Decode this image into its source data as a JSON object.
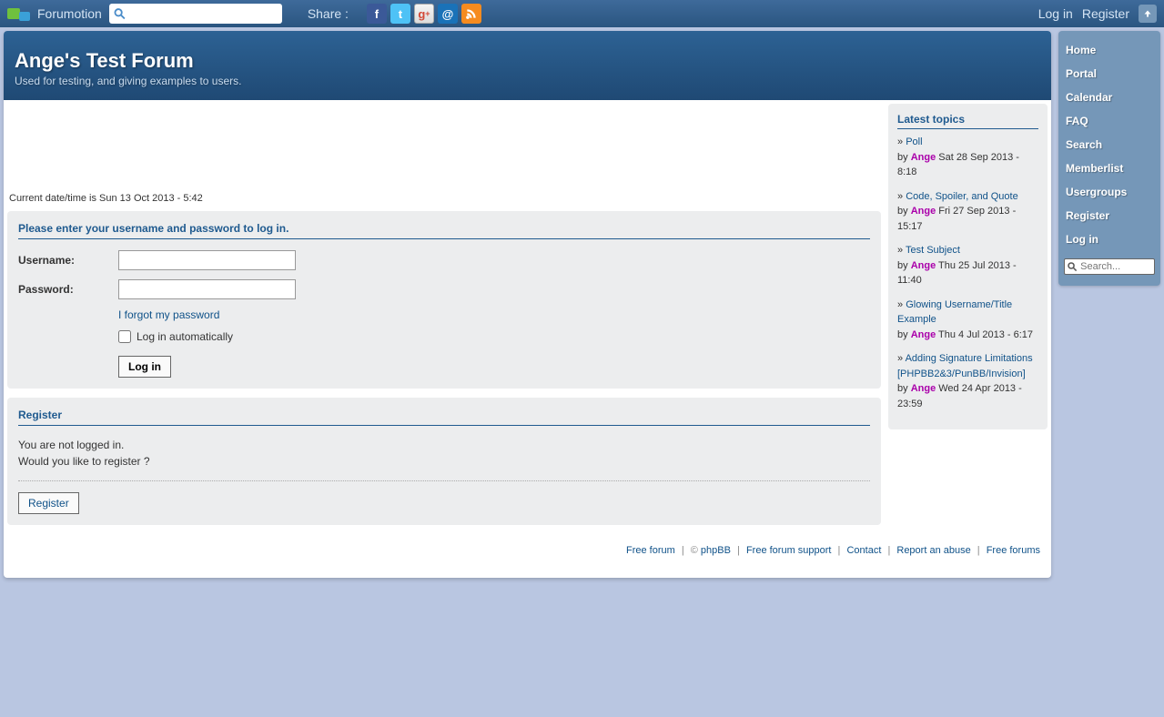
{
  "topbar": {
    "brand": "Forumotion",
    "share_label": "Share :",
    "login": "Log in",
    "register": "Register"
  },
  "banner": {
    "title": "Ange's Test Forum",
    "tagline": "Used for testing, and giving examples to users."
  },
  "datetime": "Current date/time is Sun 13 Oct 2013 - 5:42",
  "login_panel": {
    "title": "Please enter your username and password to log in.",
    "username_label": "Username:",
    "password_label": "Password:",
    "forgot": "I forgot my password",
    "auto": "Log in automatically",
    "button": "Log in"
  },
  "register_panel": {
    "title": "Register",
    "line1": "You are not logged in.",
    "line2": "Would you like to register ?",
    "button": "Register"
  },
  "latest": {
    "title": "Latest topics",
    "items": [
      {
        "title": "Poll",
        "user": "Ange",
        "ts": "Sat 28 Sep 2013 - 8:18"
      },
      {
        "title": "Code, Spoiler, and Quote",
        "user": "Ange",
        "ts": "Fri 27 Sep 2013 - 15:17"
      },
      {
        "title": "Test Subject",
        "user": "Ange",
        "ts": "Thu 25 Jul 2013 - 11:40"
      },
      {
        "title": "Glowing Username/Title Example",
        "user": "Ange",
        "ts": "Thu 4 Jul 2013 - 6:17"
      },
      {
        "title": "Adding Signature Limitations [PHPBB2&3/PunBB/Invision]",
        "user": "Ange",
        "ts": "Wed 24 Apr 2013 - 23:59"
      }
    ]
  },
  "footer": {
    "free_forum": "Free forum",
    "copy": "©",
    "phpbb": "phpBB",
    "support": "Free forum support",
    "contact": "Contact",
    "abuse": "Report an abuse",
    "forums": "Free forums"
  },
  "sidebar": {
    "items": [
      "Home",
      "Portal",
      "Calendar",
      "FAQ",
      "Search",
      "Memberlist",
      "Usergroups",
      "Register",
      "Log in"
    ],
    "search_placeholder": "Search..."
  }
}
